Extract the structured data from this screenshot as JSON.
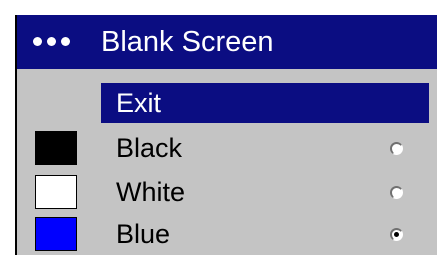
{
  "menu": {
    "title": "Blank Screen",
    "title_icon": "menu-dots-icon",
    "exit_label": "Exit",
    "options": [
      {
        "label": "Black",
        "swatch_color": "#000000",
        "selected": false
      },
      {
        "label": "White",
        "swatch_color": "#ffffff",
        "selected": false
      },
      {
        "label": "Blue",
        "swatch_color": "#0000ff",
        "selected": true
      }
    ]
  },
  "colors": {
    "highlight": "#0b0d82",
    "panel_bg": "#c4c4c4"
  }
}
